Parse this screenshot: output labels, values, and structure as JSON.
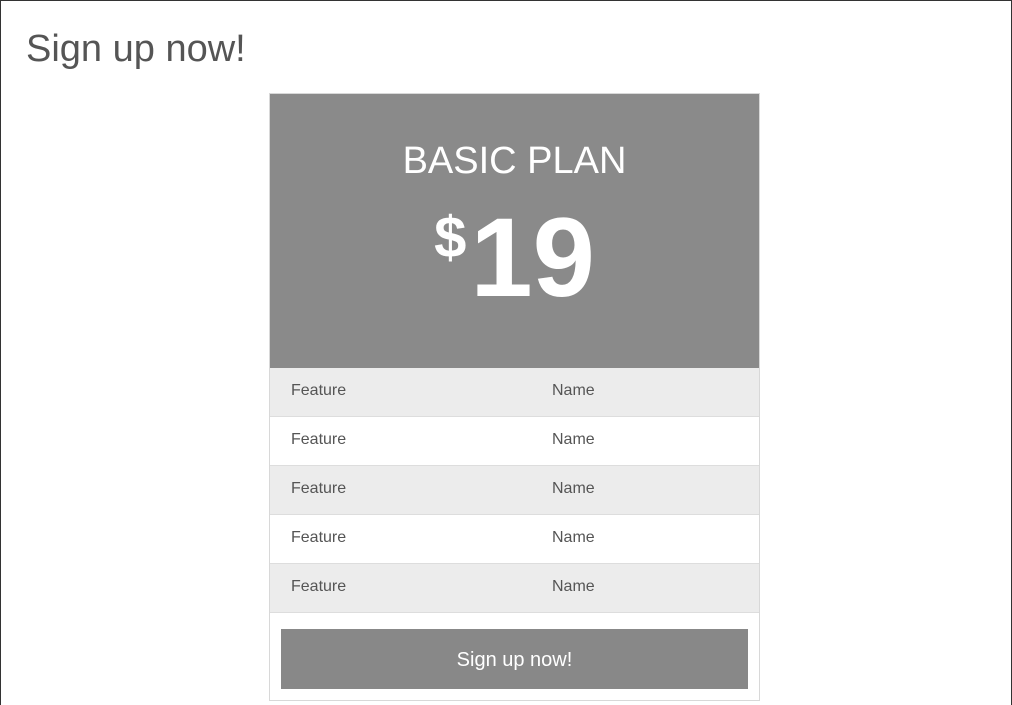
{
  "page": {
    "title": "Sign up now!"
  },
  "plan": {
    "name": "BASIC PLAN",
    "currency": "$",
    "amount": "19",
    "features": [
      {
        "label": "Feature",
        "value": "Name"
      },
      {
        "label": "Feature",
        "value": "Name"
      },
      {
        "label": "Feature",
        "value": "Name"
      },
      {
        "label": "Feature",
        "value": "Name"
      },
      {
        "label": "Feature",
        "value": "Name"
      }
    ],
    "cta_label": "Sign up now!"
  },
  "colors": {
    "header_bg": "#8a8a8a",
    "row_alt_bg": "#ececec",
    "button_bg": "#888888",
    "text_muted": "#555555"
  }
}
